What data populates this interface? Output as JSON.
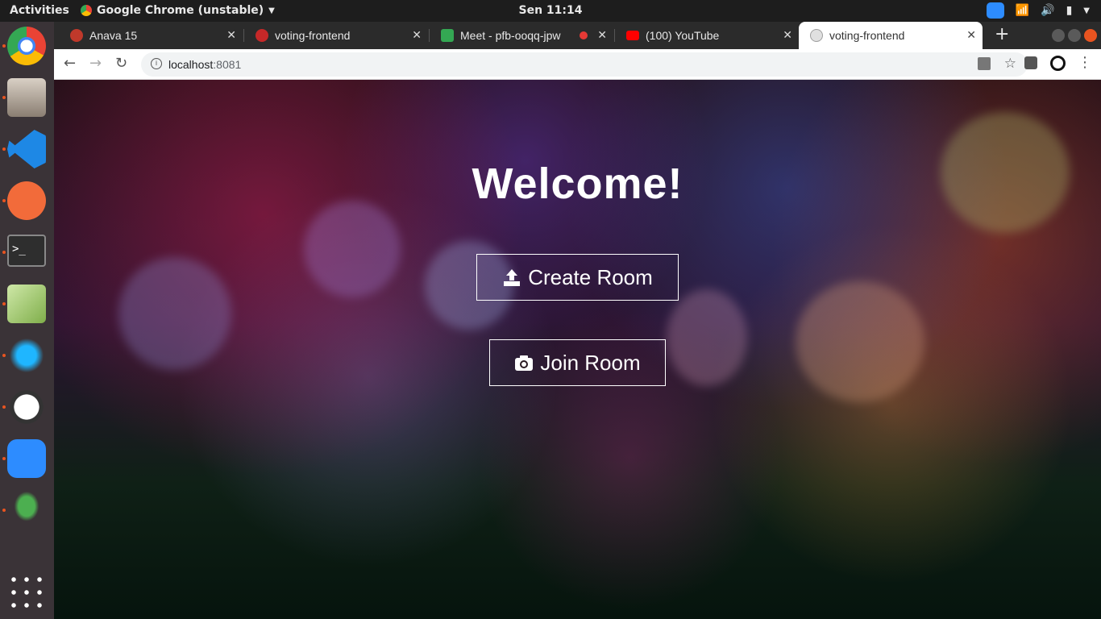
{
  "topbar": {
    "activities": "Activities",
    "app_name": "Google Chrome (unstable)",
    "clock": "Sen 11:14"
  },
  "tabs": [
    {
      "label": "Anava 15",
      "favicon_color": "#c0392b"
    },
    {
      "label": "voting-frontend",
      "favicon_color": "#c62828"
    },
    {
      "label": "Meet - pfb-ooqq-jpw",
      "favicon_color": "#34a853"
    },
    {
      "label": "(100) YouTube",
      "favicon_color": "#ff0000"
    },
    {
      "label": "voting-frontend",
      "favicon_color": "#9e9e9e"
    }
  ],
  "omnibox": {
    "host": "localhost",
    "port": ":8081"
  },
  "page": {
    "heading": "Welcome!",
    "create_label": "Create Room",
    "join_label": "Join Room"
  },
  "dock": {
    "items": [
      "chrome-dev-icon",
      "files-icon",
      "vscode-icon",
      "postman-icon",
      "terminal-icon",
      "image-viewer-icon",
      "splash-app-icon",
      "software-updater-icon",
      "zoom-icon",
      "rocket-app-icon",
      "app-grid-icon"
    ]
  },
  "colors": {
    "accent": "#e95420",
    "zoom": "#2d8cff"
  }
}
